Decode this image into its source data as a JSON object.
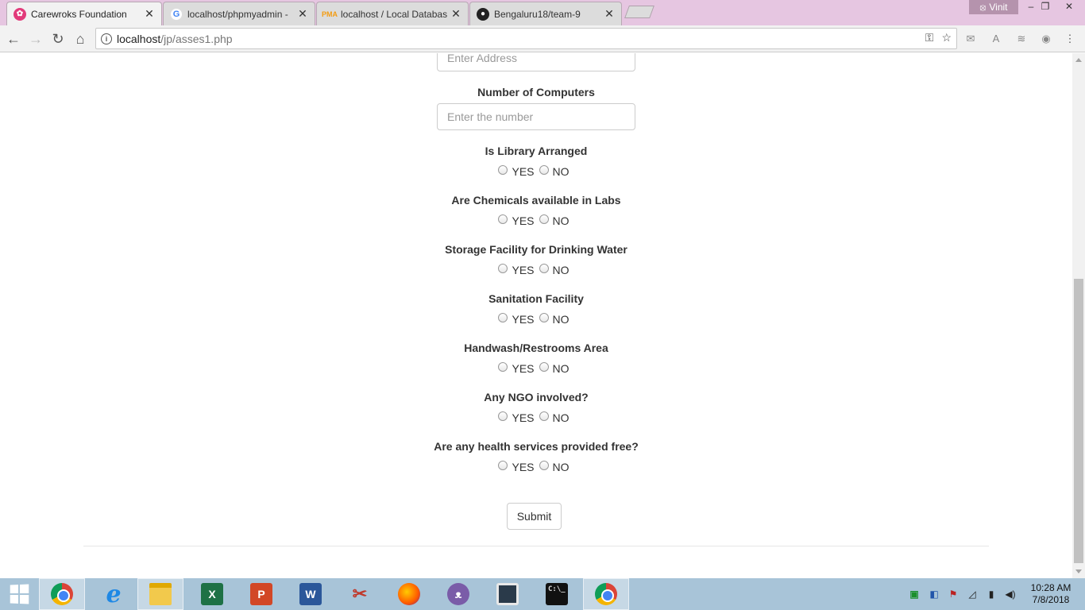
{
  "browser": {
    "tabs": [
      {
        "title": "Carewroks Foundation",
        "favicon": "carewroks-favicon",
        "active": true
      },
      {
        "title": "localhost/phpmyadmin -",
        "favicon": "google-favicon",
        "active": false
      },
      {
        "title": "localhost / Local Databas",
        "favicon": "phpmyadmin-favicon",
        "active": false
      },
      {
        "title": "Bengaluru18/team-9",
        "favicon": "github-favicon",
        "active": false
      }
    ],
    "user_name": "Vinit",
    "url_host": "localhost",
    "url_path": "/jp/asses1.php"
  },
  "form": {
    "address_placeholder": "Enter Address",
    "computers_label": "Number of Computers",
    "computers_placeholder": "Enter the number",
    "yes_label": "YES",
    "no_label": "NO",
    "questions": [
      "Is Library Arranged",
      "Are Chemicals available in Labs",
      "Storage Facility for Drinking Water",
      "Sanitation Facility",
      "Handwash/Restrooms Area",
      "Any NGO involved?",
      "Are any health services provided free?"
    ],
    "submit_label": "Submit"
  },
  "taskbar": {
    "apps": [
      "chrome",
      "internet-explorer",
      "file-explorer",
      "excel",
      "powerpoint",
      "word",
      "snipping-tool",
      "firefox",
      "cat-app",
      "box-app",
      "command-prompt",
      "chrome"
    ],
    "excel_letter": "X",
    "ppt_letter": "P",
    "word_letter": "W",
    "cmd_text": "C:\\_",
    "time": "10:28 AM",
    "date": "7/8/2018"
  },
  "colors": {
    "tabbar_bg": "#e6c6e1",
    "taskbar_bg": "#a8c4d8",
    "accent": "#e23a7a"
  }
}
